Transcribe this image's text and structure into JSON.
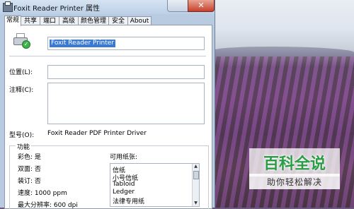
{
  "window": {
    "title": "Foxit Reader Printer 属性",
    "close_glyph": "✕"
  },
  "tabs": [
    {
      "label": "常规",
      "active": true
    },
    {
      "label": "共享",
      "active": false
    },
    {
      "label": "端口",
      "active": false
    },
    {
      "label": "高级",
      "active": false
    },
    {
      "label": "颜色管理",
      "active": false
    },
    {
      "label": "安全",
      "active": false
    },
    {
      "label": "About",
      "active": false
    }
  ],
  "general": {
    "printer_name": "Foxit Reader Printer",
    "location_label": "位置(L):",
    "location_value": "",
    "comment_label": "注释(C):",
    "comment_value": "",
    "model_label": "型号(O):",
    "model_value": "Foxit Reader PDF Printer Driver"
  },
  "features": {
    "title": "功能",
    "color": "彩色: 是",
    "duplex": "双面: 否",
    "staple": "装订: 否",
    "speed": "速度: 1000 ppm",
    "resolution": "最大分辨率: 600 dpi",
    "paper_label": "可用纸张:",
    "papers": [
      "信纸",
      "小号信纸",
      "Tabloid",
      "Ledger",
      "法律专用纸"
    ]
  },
  "watermark": {
    "top": "百科全说",
    "bottom": "助你轻松解决"
  },
  "icons": {
    "printer": "printer-icon",
    "check": "check-icon",
    "scroll_up": "▲",
    "scroll_down": "▼"
  }
}
